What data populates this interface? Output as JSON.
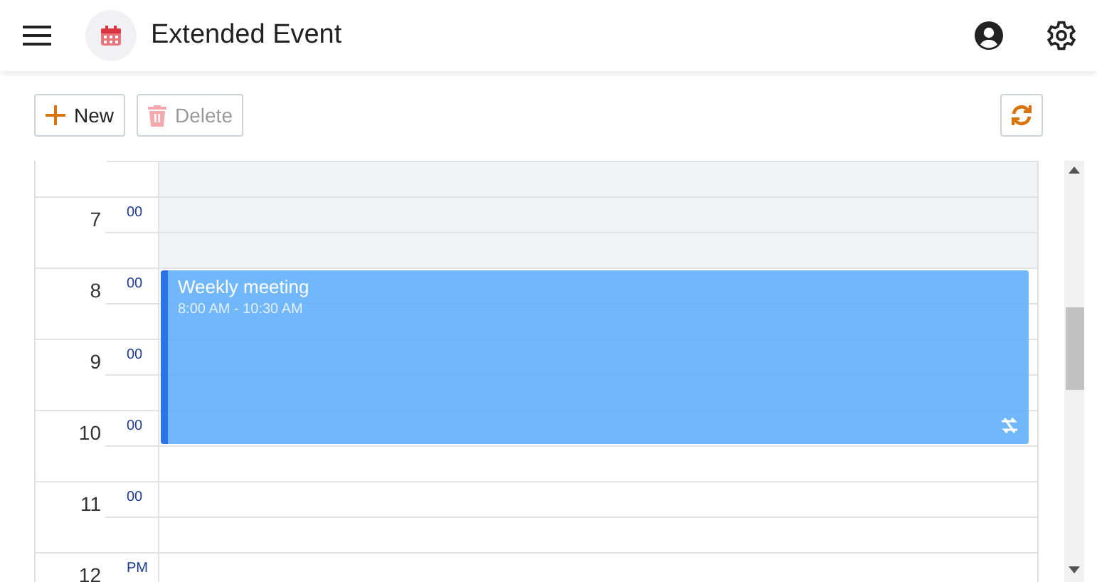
{
  "app_bar": {
    "title": "Extended Event"
  },
  "toolbar": {
    "buttons": [
      {
        "label": "New",
        "kind": "new",
        "disabled": false
      },
      {
        "label": "Delete",
        "kind": "delete",
        "disabled": true
      }
    ]
  },
  "hours": [
    {
      "hour": "7",
      "minutes": "00",
      "work": false
    },
    {
      "hour": "8",
      "minutes": "00",
      "work": true
    },
    {
      "hour": "9",
      "minutes": "00",
      "work": true
    },
    {
      "hour": "10",
      "minutes": "00",
      "work": true
    },
    {
      "hour": "11",
      "minutes": "00",
      "work": true
    },
    {
      "hour": "12",
      "minutes": "PM",
      "work": true
    }
  ],
  "event": {
    "title": "Weekly meeting",
    "time": "8:00 AM - 10:30 AM",
    "recurring": true
  }
}
